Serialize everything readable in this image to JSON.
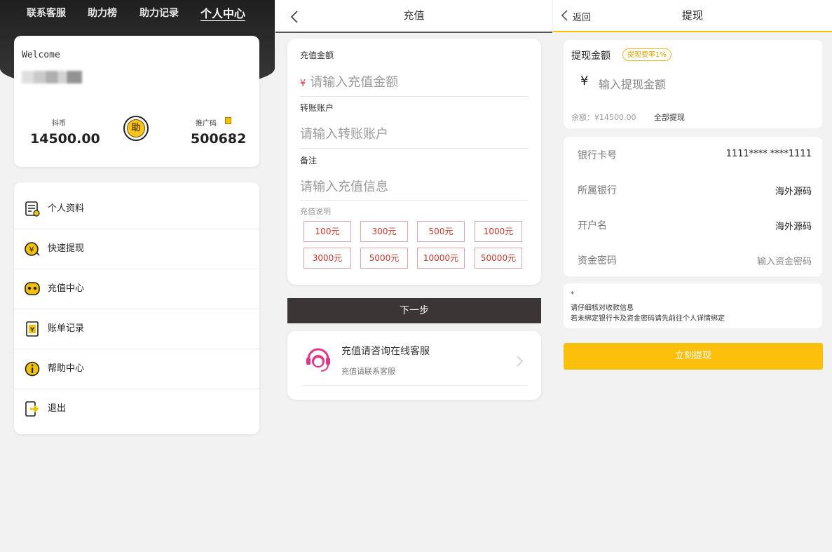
{
  "profile": {
    "nav": [
      "联系客服",
      "助力榜",
      "助力记录",
      "个人中心"
    ],
    "welcome": "Welcome",
    "coins_label": "抖币",
    "coins_value": "14500.00",
    "help_badge": "助",
    "promo_label": "推广码",
    "promo_value": "500682",
    "menu": [
      {
        "label": "个人资料",
        "icon": "profile-doc-icon"
      },
      {
        "label": "快速提现",
        "icon": "yen-withdraw-icon"
      },
      {
        "label": "充值中心",
        "icon": "recharge-face-icon"
      },
      {
        "label": "账单记录",
        "icon": "bill-yen-icon"
      },
      {
        "label": "帮助中心",
        "icon": "info-help-icon"
      },
      {
        "label": "退出",
        "icon": "exit-door-icon"
      }
    ]
  },
  "recharge": {
    "title": "充值",
    "amount_label": "充值金额",
    "amount_yen": "¥",
    "amount_placeholder": "请输入充值金额",
    "account_label": "转账账户",
    "account_placeholder": "请输入转账账户",
    "remark_label": "备注",
    "remark_placeholder": "请输入充值信息",
    "note_label": "充值说明",
    "amounts": [
      "100元",
      "300元",
      "500元",
      "1000元",
      "3000元",
      "5000元",
      "10000元",
      "50000元"
    ],
    "next_label": "下一步",
    "service_title": "充值请咨询在线客服",
    "service_sub": "充值请联系客服"
  },
  "withdraw": {
    "back_label": "返回",
    "title": "提现",
    "amount_label": "提现金额",
    "fee_tag": "提现费率1%",
    "yen": "¥",
    "amount_placeholder": "输入提现金额",
    "balance": "余额：¥14500.00",
    "withdraw_all": "全部提现",
    "rows": [
      {
        "label": "银行卡号",
        "value": "1111**** ****1111"
      },
      {
        "label": "所属银行",
        "value": "海外源码"
      },
      {
        "label": "开户名",
        "value": "海外源码"
      },
      {
        "label": "资金密码",
        "value": "输入资金密码"
      }
    ],
    "notes": [
      "*",
      "请仔细核对收款信息",
      "若未绑定银行卡及资金密码请先前往个人详情绑定"
    ],
    "submit_label": "立刻提现"
  },
  "colors": {
    "accent_yellow": "#fbbf0c",
    "dark_header": "#2a2a2a",
    "amount_red": "#c0392b",
    "service_pink": "#e0368c"
  }
}
